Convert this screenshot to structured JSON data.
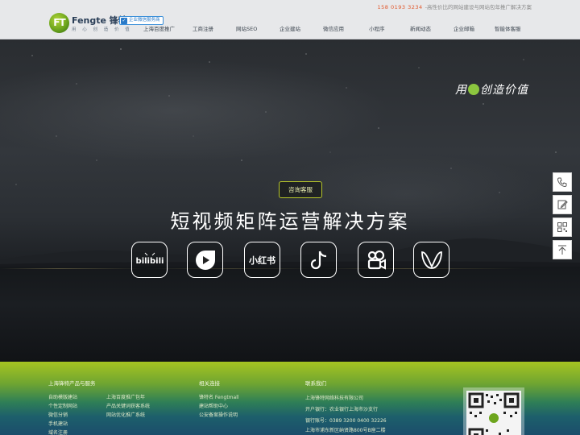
{
  "header": {
    "phone": "158 0193 3234",
    "tagline": "-高性价比的网站建设与网站包年推广解决方案",
    "logo_mark": "FT",
    "logo_name": "Fengte 锋特",
    "logo_slogan": "用 心 创 造 价 值",
    "badge": "企业微信服务商",
    "nav": [
      "上海百度推广",
      "工商注册",
      "网站SEO",
      "企业建站",
      "微信应用",
      "小程序",
      "新闻动态",
      "企业邮箱",
      "智能体客服"
    ]
  },
  "hero": {
    "slogan_part1": "用",
    "slogan_part2": "创造价值",
    "consult_label": "咨询客服",
    "title": "短视频矩阵运营解决方案",
    "platforms": [
      {
        "name": "bilibili",
        "icon": "bilibili-icon"
      },
      {
        "name": "video-channel",
        "icon": "video-channel-icon"
      },
      {
        "name": "小红书",
        "icon": "xiaohongshu-icon"
      },
      {
        "name": "douyin",
        "icon": "douyin-icon"
      },
      {
        "name": "kuaishou",
        "icon": "kuaishou-icon"
      },
      {
        "name": "wechat-channels",
        "icon": "wechat-channels-icon"
      }
    ]
  },
  "side_tools": [
    {
      "icon": "phone-icon"
    },
    {
      "icon": "edit-icon"
    },
    {
      "icon": "qrcode-icon"
    },
    {
      "icon": "back-to-top-icon"
    }
  ],
  "footer": {
    "col1": {
      "title": "上海锋特产品与服务",
      "left_links": [
        "自助模版建站",
        "个性定制网站",
        "微信分销",
        "手机建站",
        "域名注册"
      ],
      "right_links": [
        "上海百度推广包年",
        "产品关键词获客系统",
        "网站优化推广系统"
      ]
    },
    "col2": {
      "title": "相关连接",
      "links": [
        "锋特名 Fengtmall",
        "建站帮助中心",
        "公安备案操作说明"
      ]
    },
    "col3": {
      "title": "联系我们",
      "company": "上海锋特网络科技有限公司",
      "bank": "开户银行：农业银行上海市沙支行",
      "account": "银行账号：0389 3200 0400 32226",
      "address": "上海市浦东新区纳贤路800号B座二楼"
    }
  },
  "colors": {
    "accent_green": "#8cc63f",
    "phone_red": "#e2572b",
    "consult_border": "#b7c62a"
  }
}
